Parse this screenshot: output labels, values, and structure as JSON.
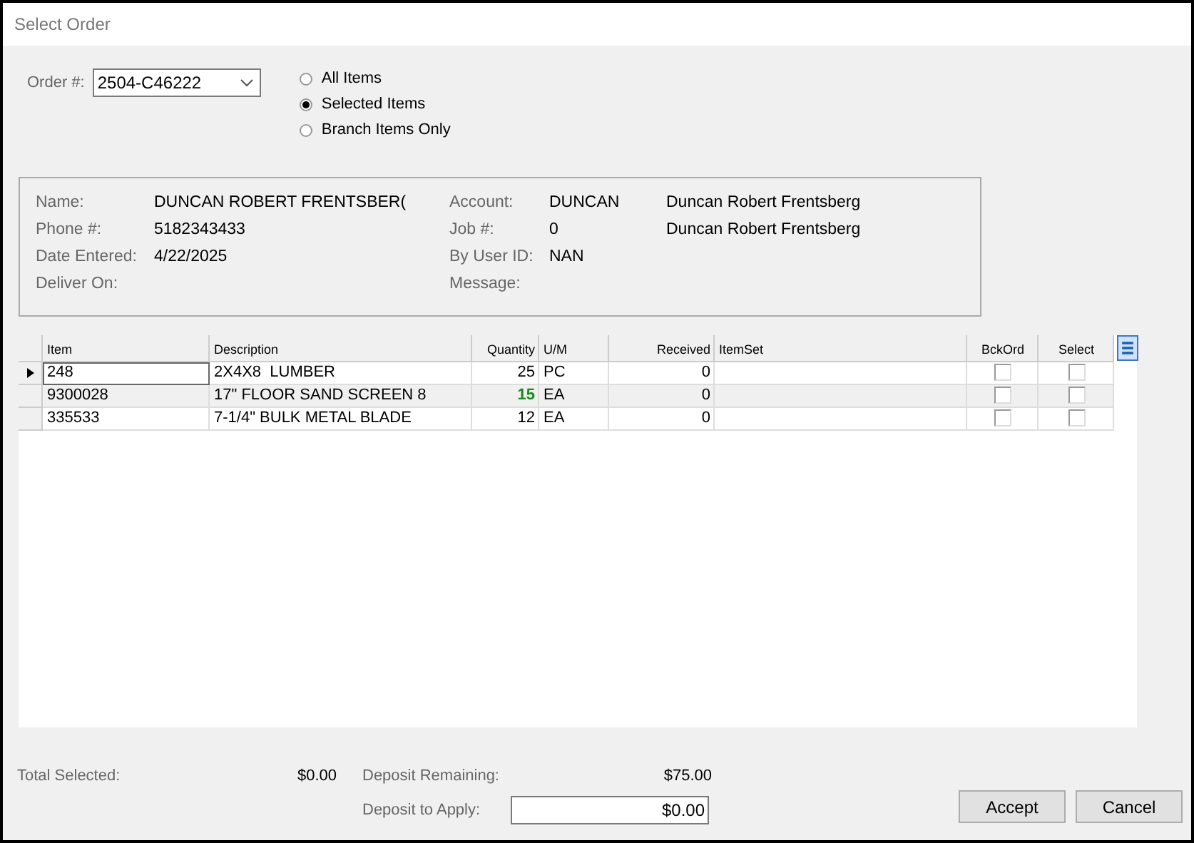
{
  "window": {
    "title": "Select Order"
  },
  "order": {
    "label": "Order #:",
    "value": "2504-C46222"
  },
  "filter_options": [
    {
      "label": "All Items",
      "selected": false
    },
    {
      "label": "Selected Items",
      "selected": true
    },
    {
      "label": "Branch Items Only",
      "selected": false
    }
  ],
  "customer": {
    "left": [
      {
        "label": "Name:",
        "value": "DUNCAN ROBERT FRENTSBER("
      },
      {
        "label": "Phone #:",
        "value": "5182343433"
      },
      {
        "label": "Date Entered:",
        "value": "4/22/2025"
      },
      {
        "label": "Deliver On:"
      }
    ],
    "right": [
      {
        "label": "Account:",
        "value": "DUNCAN",
        "extra": "Duncan Robert Frentsberg"
      },
      {
        "label": "Job #:",
        "value": "0",
        "extra": "Duncan Robert Frentsberg"
      },
      {
        "label": "By User ID:",
        "value": "NAN"
      },
      {
        "label": "Message:"
      }
    ]
  },
  "table": {
    "columns": [
      "Item",
      "Description",
      "Quantity",
      "U/M",
      "Received",
      "ItemSet",
      "BckOrd",
      "Select"
    ],
    "rows": [
      {
        "current": true,
        "item": "248",
        "description": "2X4X8  LUMBER",
        "quantity": "25",
        "quantity_highlighted": false,
        "um": "PC",
        "received": "0",
        "backorder": false,
        "select": false
      },
      {
        "current": false,
        "item": "9300028",
        "description": "17\" FLOOR SAND SCREEN 8",
        "quantity": "15",
        "quantity_highlighted": true,
        "um": "EA",
        "received": "0",
        "backorder": false,
        "select": false
      },
      {
        "current": false,
        "item": "335533",
        "description": "7-1/4\" BULK METAL BLADE",
        "quantity": "12",
        "quantity_highlighted": false,
        "um": "EA",
        "received": "0",
        "backorder": false,
        "select": false
      }
    ]
  },
  "totals": {
    "total_selected_label": "Total Selected:",
    "total_selected": "$0.00",
    "deposit_remaining_label": "Deposit Remaining:",
    "deposit_remaining": "$75.00",
    "deposit_apply_label": "Deposit to Apply:",
    "deposit_apply": "$0.00"
  },
  "buttons": [
    "Accept",
    "Cancel"
  ]
}
